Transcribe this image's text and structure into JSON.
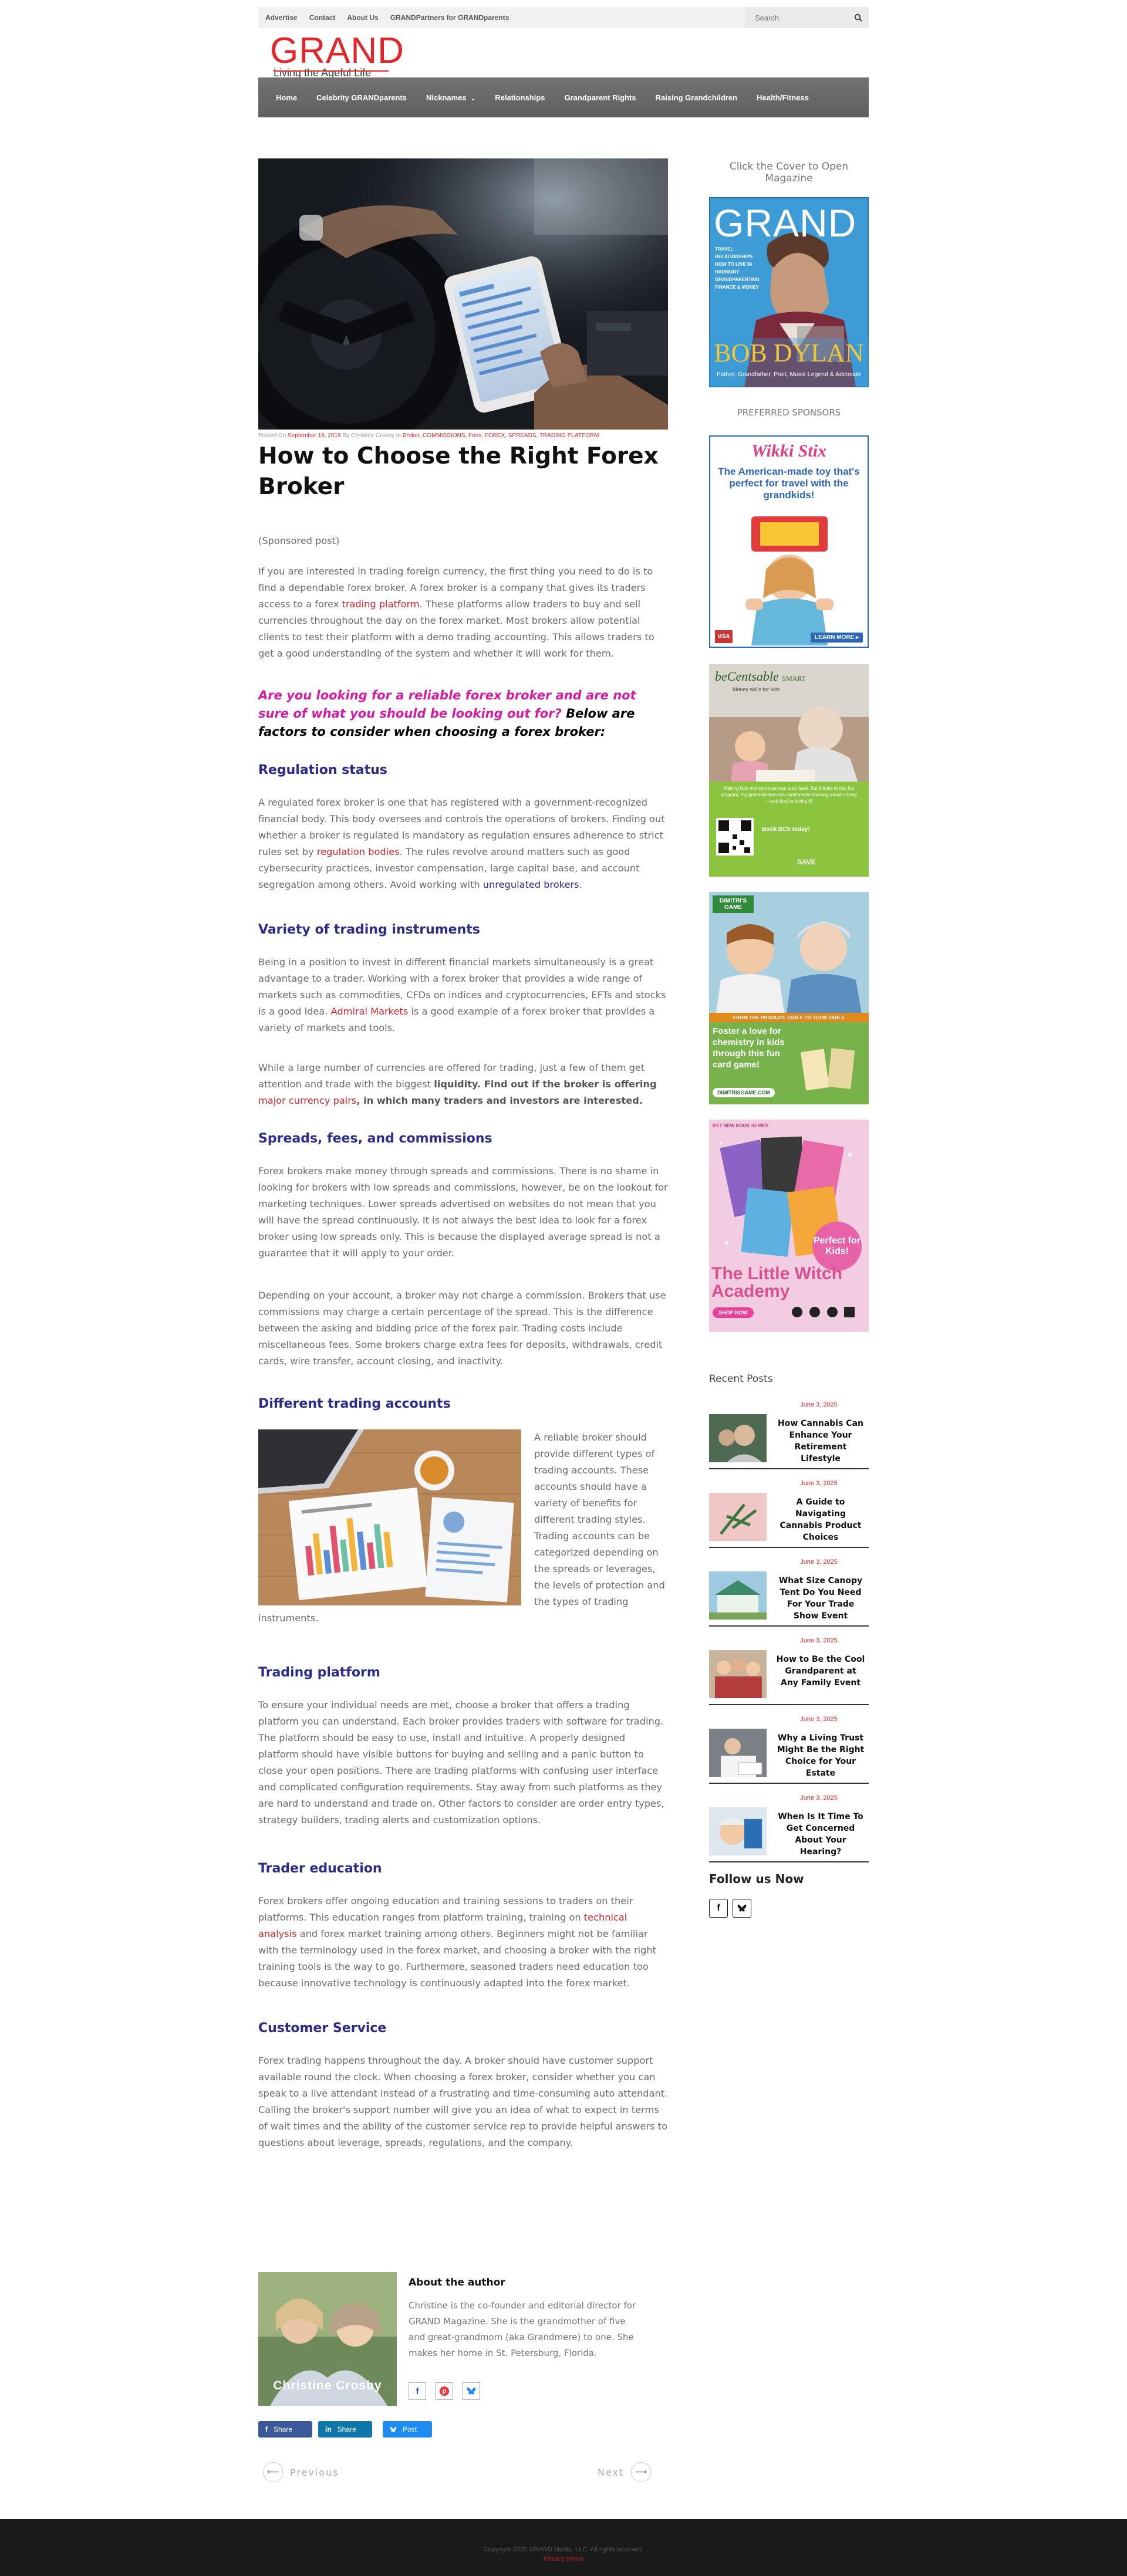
{
  "topbar": {
    "links": [
      "Advertise",
      "Contact",
      "About Us",
      "GRANDPartners for GRANDparents"
    ],
    "search_placeholder": "Search"
  },
  "logo": {
    "word": "GRAND",
    "tagline": "Living the Ageful Life"
  },
  "nav": [
    "Home",
    "Celebrity GRANDparents",
    "Nicknames",
    "Relationships",
    "Grandparent Rights",
    "Raising Grandchildren",
    "Health/Fitness"
  ],
  "article": {
    "meta": {
      "prefix": "Posted On",
      "date": "September 19, 2019",
      "by": "By Christine Crosby",
      "in": "In",
      "categories": "Broker, COMMISSIONS, Fees, FOREX, SPREADS, TRADING PLATFORM"
    },
    "title": "How to Choose the Right Forex Broker",
    "sponsored": "(Sponsored post)",
    "intro": {
      "a": "If you are interested in trading foreign currency, the first thing you need to do is to find a dependable forex broker. A forex broker is a company that gives its traders access to a forex ",
      "link": "trading platform",
      "b": ". These platforms allow traders to buy and sell currencies throughout the day on the forex market. Most brokers allow potential clients to test their platform with a demo trading accounting. This allows traders to get a good understanding of the system and whether it will work for them."
    },
    "callout_pink": "Are you looking for a reliable forex broker and are not sure of what you should be looking out for?",
    "callout_black": " Below are factors to consider when choosing a forex broker:",
    "s1": {
      "h": "Regulation status",
      "a": "A regulated forex broker is one that has registered with a government-recognized financial body. This body oversees and controls the operations of brokers. Finding out whether a broker is regulated is mandatory as regulation ensures adherence to strict rules set by ",
      "link1": "regulation bodies",
      "b": ". The rules revolve around matters such as good cybersecurity practices, investor compensation, large capital base, and account segregation among others. Avoid working with ",
      "link2": "unregulated brokers",
      "c": "."
    },
    "s2": {
      "h": "Variety of trading instruments",
      "a": "Being in a position to invest in different financial markets simultaneously is a great advantage to a trader. Working with a forex broker that provides a wide range of markets such as commodities, CFDs on indices and cryptocurrencies, EFTs and stocks is a good idea. ",
      "link": "Admiral Markets",
      "b": " is a good example of a forex broker that provides a variety of markets and tools.",
      "p2a": "While a large number of currencies are offered for trading, just a few of them get attention and trade with the biggest ",
      "p2b": "liquidity. Find out if the broker is offering ",
      "p2link": "major currency pairs",
      "p2c": ", in which many traders and investors are interested."
    },
    "s3": {
      "h": "Spreads, fees, and commissions",
      "p1": "Forex brokers make money through spreads and commissions. There is no shame in looking for brokers with low spreads and commissions, however, be on the lookout for marketing techniques. Lower spreads advertised on websites do not mean that you will have the spread continuously. It is not always the best idea to look for a forex broker using low spreads only. This is because the displayed average spread is not a guarantee that it will apply to your order.",
      "p2": " Depending on your account, a broker may not charge a commission. Brokers that use commissions may charge a certain percentage of the spread. This is the difference between the asking and bidding price of the forex pair. Trading costs include miscellaneous fees. Some brokers charge extra fees for deposits, withdrawals, credit cards, wire transfer, account closing, and inactivity."
    },
    "s4": {
      "h": "Different trading accounts",
      "p": "A reliable broker should provide different types of trading accounts. These accounts should have a variety of benefits for different trading styles. Trading accounts can be categorized depending on the spreads or leverages, the levels of protection and the types of trading instruments."
    },
    "s5": {
      "h": "Trading platform",
      "p": "To ensure your individual needs are met, choose a broker that offers a trading platform you can understand. Each broker provides traders with software for trading. The platform should be easy to use, install and intuitive. A properly designed platform should have visible buttons for buying and selling and a panic button to close your open positions. There are trading platforms with confusing user interface and complicated configuration requirements. Stay away from such platforms as they are hard to understand and trade on. Other factors to consider are order entry types, strategy builders, trading alerts and customization options."
    },
    "s6": {
      "h": "Trader education",
      "a": "Forex brokers offer ongoing education and training sessions to traders on their platforms. This education ranges from platform training, training on ",
      "link": "technical analysis",
      "b": " and forex market training among others. Beginners might not be familiar with the terminology used in the forex market, and choosing a broker with the right training tools is the way to go. Furthermore, seasoned traders need education too because innovative technology is continuously adapted into the forex market."
    },
    "s7": {
      "h": "Customer Service",
      "p": "Forex trading happens throughout the day. A broker should have customer support available round the clock. When choosing a forex broker, consider whether you can speak to a live attendant instead of a frustrating and time-consuming auto attendant. Calling the broker's support number will give you an idea of what to expect in terms of wait times and the ability of the customer service rep to provide helpful answers to questions about leverage, spreads, regulations, and the company."
    }
  },
  "sidebar": {
    "cover_caption": "Click the Cover to Open Magazine",
    "cover": {
      "word": "GRAND",
      "items": [
        "TRAVEL",
        "RELATIONSHIPS",
        "HOW TO LIVE IN HARMONY",
        "GRANDPARENTING",
        "FINANCE & MONEY"
      ],
      "name": "BOB DYLAN",
      "sub": "Father, Grandfather, Poet, Music Legend & Advocate"
    },
    "sponsors_title": "PREFERRED SPONSORS",
    "ads": {
      "wikki": {
        "brand": "Wikki Stix",
        "headline": "The American-made toy that's perfect for travel with the grandkids!",
        "cta": "LEARN MORE ▸",
        "badge": "USA"
      },
      "centsable": {
        "brand": "beCentsable",
        "brand2": "SMART",
        "tag": "Money skills for kids",
        "quote": "Making kids money-conscious is so hard. But thanks to this fun program, my grandchildren are comfortable learning about money—and they're loving it!",
        "cta": "Book BCS today!",
        "save": "SAVE"
      },
      "dimitris": {
        "brand": "DIMITRI'S GAME",
        "sub": "FROM THE PRODUCE TABLE TO YOUR TABLE",
        "headline": "Foster a love for chemistry in kids through this fun card game!",
        "url": "DIMITRISGAME.COM"
      },
      "witch": {
        "top": "GET NEW BOOK SERIES",
        "badge": "Perfect for Kids!",
        "title": "The Little Witch Academy",
        "cta": "SHOP NOW"
      }
    },
    "recent_title": "Recent Posts",
    "recent": [
      {
        "date": "June 3, 2025",
        "title": "How Cannabis Can Enhance Your Retirement Lifestyle"
      },
      {
        "date": "June 3, 2025",
        "title": "A Guide to Navigating Cannabis Product Choices"
      },
      {
        "date": "June 3, 2025",
        "title": "What Size Canopy Tent Do You Need For Your Trade Show Event"
      },
      {
        "date": "June 3, 2025",
        "title": "How to Be the Cool Grandparent at Any Family Event"
      },
      {
        "date": "June 3, 2025",
        "title": "Why a Living Trust Might Be the Right Choice for Your Estate"
      },
      {
        "date": "June 3, 2025",
        "title": "When Is It Time To Get Concerned About Your Hearing?"
      }
    ],
    "follow_title": "Follow us Now"
  },
  "author": {
    "heading": "About the author",
    "img_name": "Christine Crosby",
    "bio": "Christine is the co-founder and editorial director for GRAND Magazine. She is the grandmother of five and great-grandmom (aka Grandmere) to one. She makes her home in St. Petersburg, Florida."
  },
  "share": {
    "facebook": "Share",
    "linkedin": "Share",
    "twitter": "Post"
  },
  "pager": {
    "prev": "Previous",
    "next": "Next"
  },
  "footer": {
    "copyright": "Copyright 2025 GRAND Media, LLC. All rights reserved.",
    "privacy": "Privacy Policy"
  },
  "colors": {
    "brand_red": "#e2262b",
    "heading_blue": "#2b2b8c",
    "callout_pink": "#d61aa6",
    "nav_gray": "#6a6a6a",
    "footer": "#1a1a1a"
  }
}
